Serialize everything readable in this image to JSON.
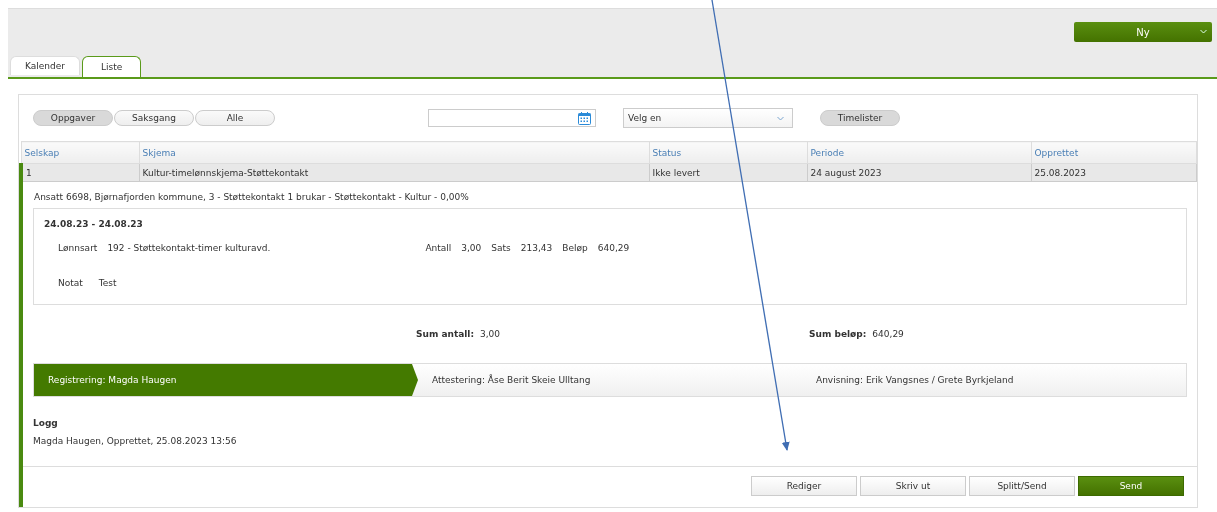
{
  "header": {
    "new_button": "Ny"
  },
  "tabs": [
    {
      "label": "Kalender",
      "selected": false
    },
    {
      "label": "Liste",
      "selected": true
    }
  ],
  "filters": [
    {
      "label": "Oppgaver",
      "selected": true
    },
    {
      "label": "Saksgang",
      "selected": false
    },
    {
      "label": "Alle",
      "selected": false
    }
  ],
  "select": {
    "value": "Velg en"
  },
  "timelister_button": {
    "label": "Timelister",
    "selected": true
  },
  "table": {
    "columns": [
      "Selskap",
      "Skjema",
      "Status",
      "Periode",
      "Opprettet"
    ],
    "rows": [
      {
        "cells": [
          "1",
          "Kultur-timelønnskjema-Støttekontakt",
          "Ikke levert",
          "24 august 2023",
          "25.08.2023"
        ],
        "expanded": true
      }
    ]
  },
  "details": {
    "employee": "Ansatt 6698, Bjørnafjorden kommune, 3 - Støttekontakt 1 brukar - Støttekontakt - Kultur - 0,00%",
    "date_range": "24.08.23 - 24.08.23",
    "line": {
      "type_label": "Lønnsart",
      "type_value": "192 - Støttekontakt-timer kulturavd.",
      "count_label": "Antall",
      "count_value": "3,00",
      "rate_label": "Sats",
      "rate_value": "213,43",
      "amount_label": "Beløp",
      "amount_value": "640,29"
    },
    "note": {
      "label": "Notat",
      "value": "Test"
    },
    "sum_count": {
      "label": "Sum antall:",
      "value": "3,00"
    },
    "sum_amount": {
      "label": "Sum beløp:",
      "value": "640,29"
    }
  },
  "workflow": [
    {
      "label": "Registrering: Magda Haugen",
      "selected": true
    },
    {
      "label": "Attestering: Åse Berit Skeie Ulltang",
      "selected": false
    },
    {
      "label": "Anvisning: Erik Vangsnes / Grete Byrkjeland",
      "selected": false
    }
  ],
  "log": {
    "title": "Logg",
    "entries": [
      "Magda Haugen, Opprettet, 25.08.2023 13:56"
    ]
  },
  "actions": [
    {
      "label": "Rediger",
      "kind": "default"
    },
    {
      "label": "Skriv ut",
      "kind": "default"
    },
    {
      "label": "Splitt/Send",
      "kind": "default"
    },
    {
      "label": "Send",
      "kind": "primary"
    }
  ]
}
